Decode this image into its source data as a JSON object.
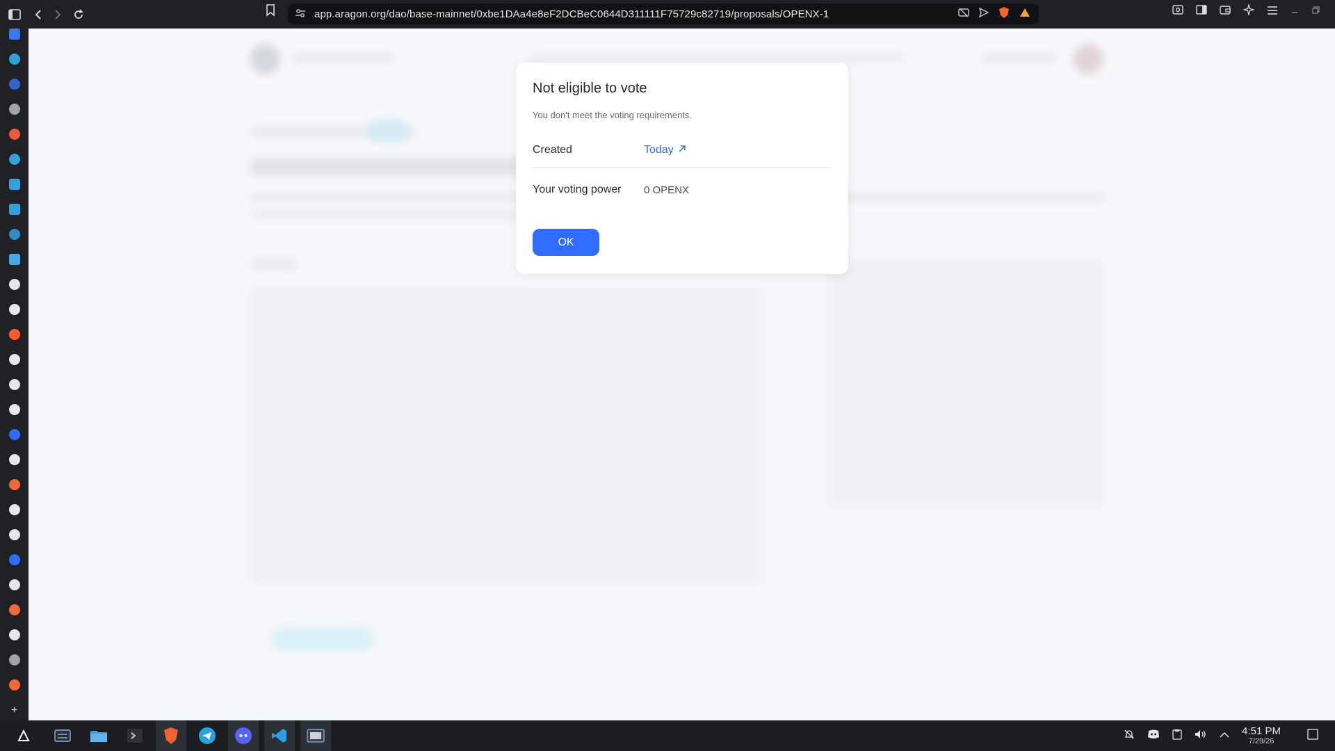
{
  "browser": {
    "url": "app.aragon.org/dao/base-mainnet/0xbe1DAa4e8eF2DCBeC0644D311111F75729c82719/proposals/OPENX-1",
    "icons": [
      "sidebar-toggle-icon",
      "back-icon",
      "forward-icon",
      "reload-icon",
      "bookmark-icon",
      "site-settings-icon",
      "camera-off-icon",
      "send-icon",
      "brave-shield-icon",
      "brave-rewards-icon",
      "screenshot-icon",
      "reader-icon",
      "wallet-icon",
      "ai-assistant-icon",
      "menu-icon",
      "minimize-icon",
      "restore-icon"
    ]
  },
  "modal": {
    "title": "Not eligible to vote",
    "subtitle": "You don't meet the voting requirements.",
    "created_label": "Created",
    "created_value": "Today",
    "voting_power_label": "Your voting power",
    "voting_power_value": "0 OPENX",
    "ok_label": "OK"
  },
  "colors": {
    "primary": "#2f6cff",
    "link": "#2f6dec",
    "background": "#f7f8fb"
  },
  "taskbar": {
    "time": "4:51 PM",
    "date": "7/29/26"
  }
}
